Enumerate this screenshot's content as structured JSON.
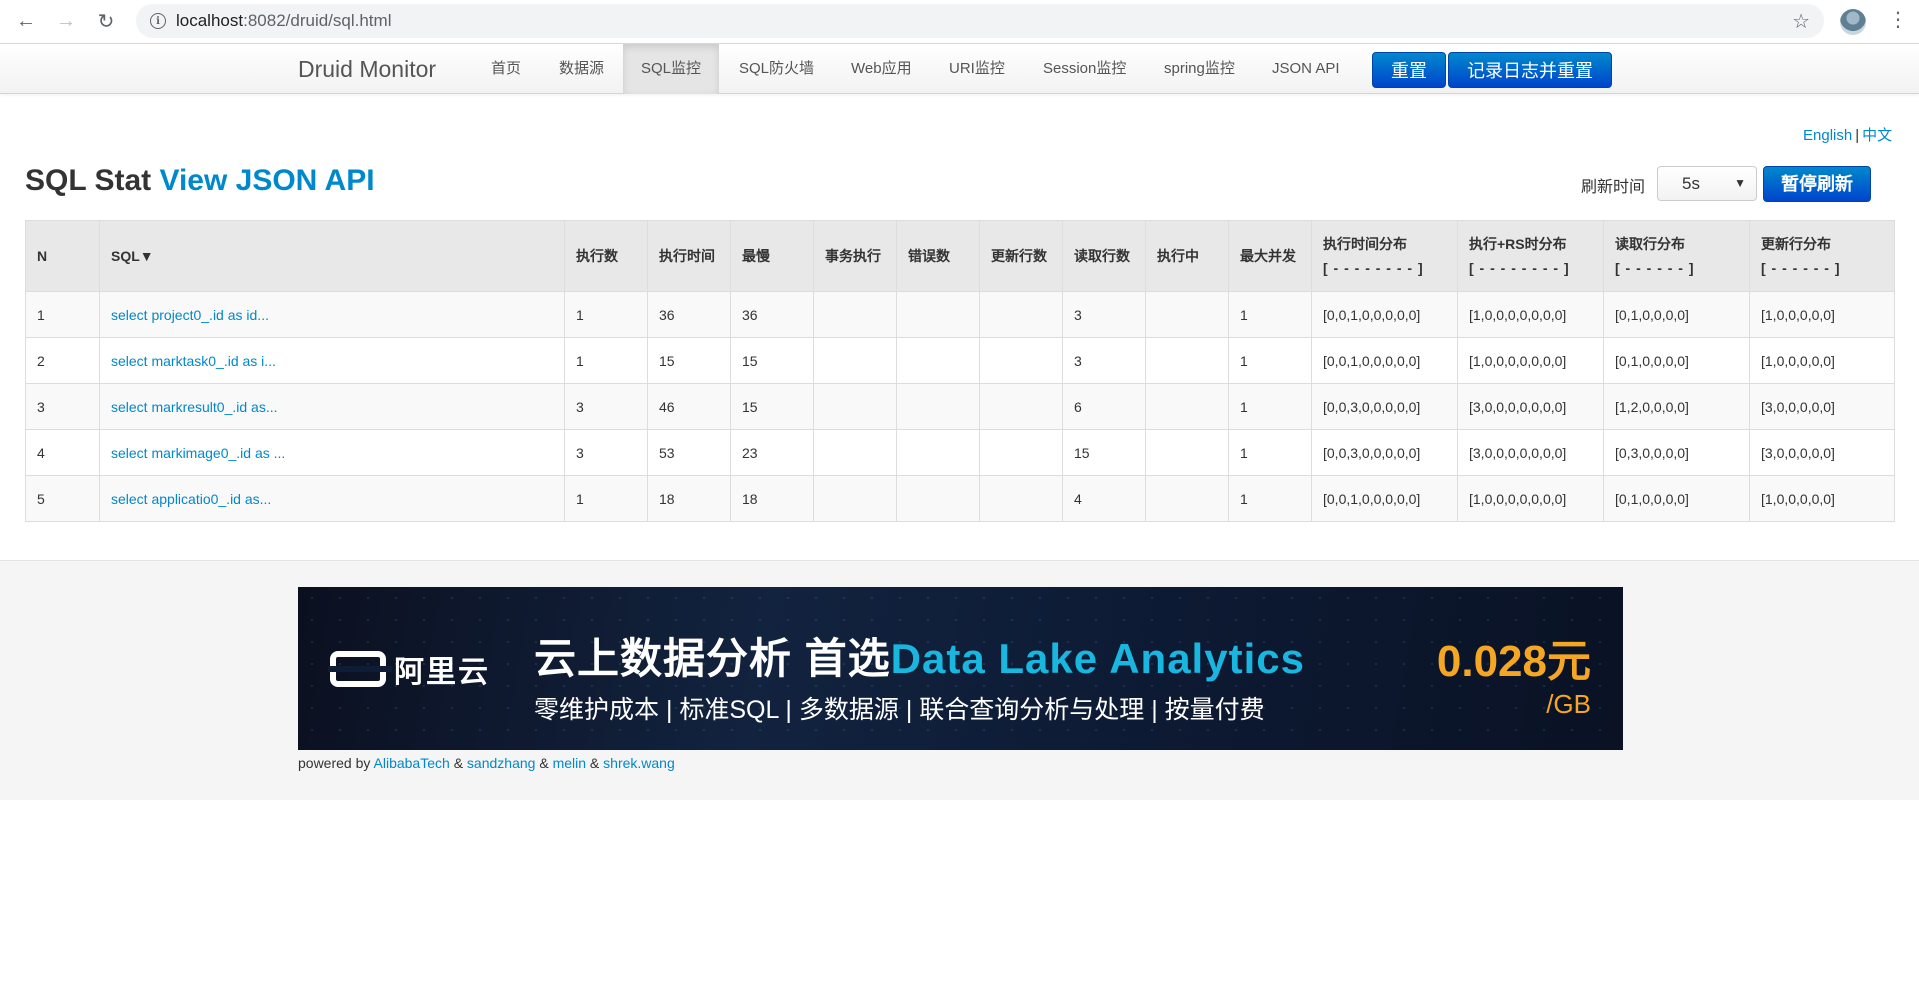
{
  "browser": {
    "url_host": "localhost",
    "url_path": ":8082/druid/sql.html"
  },
  "navbar": {
    "brand": "Druid Monitor",
    "items": [
      "首页",
      "数据源",
      "SQL监控",
      "SQL防火墙",
      "Web应用",
      "URI监控",
      "Session监控",
      "spring监控",
      "JSON API"
    ],
    "active_index": 2,
    "reset_label": "重置",
    "log_reset_label": "记录日志并重置"
  },
  "lang": {
    "english": "English",
    "separator": "|",
    "chinese": "中文"
  },
  "page": {
    "title": "SQL Stat",
    "title_link": "View JSON API",
    "refresh_label": "刷新时间",
    "refresh_value": "5s",
    "pause_label": "暂停刷新"
  },
  "table": {
    "headers": {
      "n": "N",
      "sql": "SQL▼",
      "exec_count": "执行数",
      "exec_time": "执行时间",
      "slowest": "最慢",
      "tx_exec": "事务执行",
      "errors": "错误数",
      "update_rows": "更新行数",
      "read_rows": "读取行数",
      "running": "执行中",
      "max_concurrent": "最大并发",
      "exec_dist": "执行时间分布",
      "exec_dist_sub": "[ - - - - - - - - ]",
      "rs_dist": "执行+RS时分布",
      "rs_dist_sub": "[ - - - - - - - - ]",
      "read_dist": "读取行分布",
      "read_dist_sub": "[ - - - - - - ]",
      "update_dist": "更新行分布",
      "update_dist_sub": "[ - - - - - - ]"
    },
    "rows": [
      {
        "n": "1",
        "sql": "select project0_.id as id...",
        "exec_count": "1",
        "exec_time": "36",
        "slowest": "36",
        "tx_exec": "",
        "errors": "",
        "update_rows": "",
        "read_rows": "3",
        "running": "",
        "max_concurrent": "1",
        "exec_dist": "[0,0,1,0,0,0,0,0]",
        "rs_dist": "[1,0,0,0,0,0,0,0]",
        "read_dist": "[0,1,0,0,0,0]",
        "update_dist": "[1,0,0,0,0,0]"
      },
      {
        "n": "2",
        "sql": "select marktask0_.id as i...",
        "exec_count": "1",
        "exec_time": "15",
        "slowest": "15",
        "tx_exec": "",
        "errors": "",
        "update_rows": "",
        "read_rows": "3",
        "running": "",
        "max_concurrent": "1",
        "exec_dist": "[0,0,1,0,0,0,0,0]",
        "rs_dist": "[1,0,0,0,0,0,0,0]",
        "read_dist": "[0,1,0,0,0,0]",
        "update_dist": "[1,0,0,0,0,0]"
      },
      {
        "n": "3",
        "sql": "select markresult0_.id as...",
        "exec_count": "3",
        "exec_time": "46",
        "slowest": "15",
        "tx_exec": "",
        "errors": "",
        "update_rows": "",
        "read_rows": "6",
        "running": "",
        "max_concurrent": "1",
        "exec_dist": "[0,0,3,0,0,0,0,0]",
        "rs_dist": "[3,0,0,0,0,0,0,0]",
        "read_dist": "[1,2,0,0,0,0]",
        "update_dist": "[3,0,0,0,0,0]"
      },
      {
        "n": "4",
        "sql": "select markimage0_.id as ...",
        "exec_count": "3",
        "exec_time": "53",
        "slowest": "23",
        "tx_exec": "",
        "errors": "",
        "update_rows": "",
        "read_rows": "15",
        "running": "",
        "max_concurrent": "1",
        "exec_dist": "[0,0,3,0,0,0,0,0]",
        "rs_dist": "[3,0,0,0,0,0,0,0]",
        "read_dist": "[0,3,0,0,0,0]",
        "update_dist": "[3,0,0,0,0,0]"
      },
      {
        "n": "5",
        "sql": "select applicatio0_.id as...",
        "exec_count": "1",
        "exec_time": "18",
        "slowest": "18",
        "tx_exec": "",
        "errors": "",
        "update_rows": "",
        "read_rows": "4",
        "running": "",
        "max_concurrent": "1",
        "exec_dist": "[0,0,1,0,0,0,0,0]",
        "rs_dist": "[1,0,0,0,0,0,0,0]",
        "read_dist": "[0,1,0,0,0,0]",
        "update_dist": "[1,0,0,0,0,0]"
      }
    ]
  },
  "banner": {
    "logo_text": "阿里云",
    "headline": "云上数据分析 首选",
    "headline_highlight": "Data Lake Analytics",
    "subline": "零维护成本 | 标准SQL | 多数据源 | 联合查询分析与处理 | 按量付费",
    "price": "0.028元",
    "unit": "/GB"
  },
  "footer": {
    "powered_by": "powered by",
    "authors": [
      "AlibabaTech",
      "sandzhang",
      "melin",
      "shrek.wang"
    ],
    "amp": "&"
  },
  "colors": {
    "link": "#0088cc",
    "primary_button": "#0055cc",
    "price": "#f5a623",
    "highlight": "#19b6e0"
  }
}
